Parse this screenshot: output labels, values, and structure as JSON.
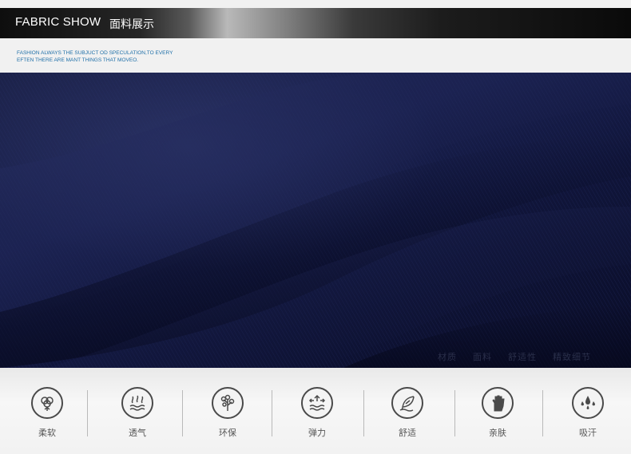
{
  "header": {
    "title_en": "FABRIC SHOW",
    "title_zh": "面料展示"
  },
  "tagline": {
    "line1": "FASHION ALWAYS THE  SUBJUCT OD SPECULATION,TO EVERY",
    "line2": "EFTEN THERE ARE MANT THINGS THAT MOVEO."
  },
  "fabric_overlay": [
    "材质",
    "面料",
    "舒适性",
    "精致细节"
  ],
  "features": [
    {
      "label": "柔软",
      "icon": "cotton-icon"
    },
    {
      "label": "透气",
      "icon": "breathable-icon"
    },
    {
      "label": "环保",
      "icon": "eco-tree-icon"
    },
    {
      "label": "弹力",
      "icon": "stretch-icon"
    },
    {
      "label": "舒适",
      "icon": "feather-icon"
    },
    {
      "label": "亲肤",
      "icon": "hand-icon"
    },
    {
      "label": "吸汗",
      "icon": "sweat-drop-icon"
    }
  ],
  "colors": {
    "fabric": "#1a2150",
    "tagline": "#1e6fa8",
    "icon_stroke": "#4a4a4a"
  }
}
